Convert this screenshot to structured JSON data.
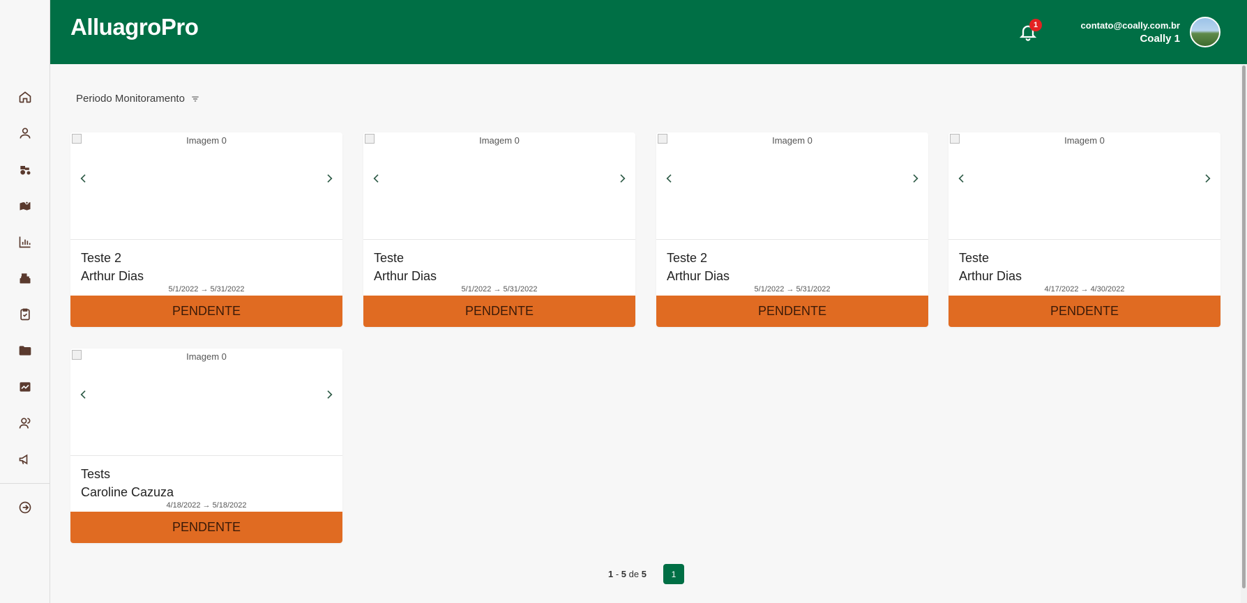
{
  "app": {
    "title": "AlluagroPro"
  },
  "header": {
    "notification_count": "1",
    "user_email": "contato@coally.com.br",
    "user_name": "Coally 1"
  },
  "sidebar": {
    "items": [
      {
        "icon": "home-icon"
      },
      {
        "icon": "user-icon"
      },
      {
        "icon": "tractor-icon"
      },
      {
        "icon": "map-icon"
      },
      {
        "icon": "bar-chart-icon"
      },
      {
        "icon": "cash-register-icon"
      },
      {
        "icon": "clipboard-check-icon"
      },
      {
        "icon": "folder-icon"
      },
      {
        "icon": "monitor-chart-icon"
      },
      {
        "icon": "users-icon"
      },
      {
        "icon": "megaphone-icon"
      }
    ],
    "footer_icon": "arrow-circle-right-icon"
  },
  "filter": {
    "label": "Periodo Monitoramento"
  },
  "cards": [
    {
      "image_alt": "Imagem 0",
      "title": "Teste 2",
      "owner": "Arthur Dias",
      "date_start": "5/1/2022",
      "date_end": "5/31/2022",
      "status": "PENDENTE"
    },
    {
      "image_alt": "Imagem 0",
      "title": "Teste",
      "owner": "Arthur Dias",
      "date_start": "5/1/2022",
      "date_end": "5/31/2022",
      "status": "PENDENTE"
    },
    {
      "image_alt": "Imagem 0",
      "title": "Teste 2",
      "owner": "Arthur Dias",
      "date_start": "5/1/2022",
      "date_end": "5/31/2022",
      "status": "PENDENTE"
    },
    {
      "image_alt": "Imagem 0",
      "title": "Teste",
      "owner": "Arthur Dias",
      "date_start": "4/17/2022",
      "date_end": "4/30/2022",
      "status": "PENDENTE"
    },
    {
      "image_alt": "Imagem 0",
      "title": "Tests",
      "owner": "Caroline Cazuza",
      "date_start": "4/18/2022",
      "date_end": "5/18/2022",
      "status": "PENDENTE"
    }
  ],
  "pagination": {
    "from": "1",
    "to": "5",
    "of_label": "de",
    "total": "5",
    "current_page": "1"
  },
  "colors": {
    "primary": "#006f45",
    "status_pending": "#e06b22",
    "badge": "#e32222"
  }
}
